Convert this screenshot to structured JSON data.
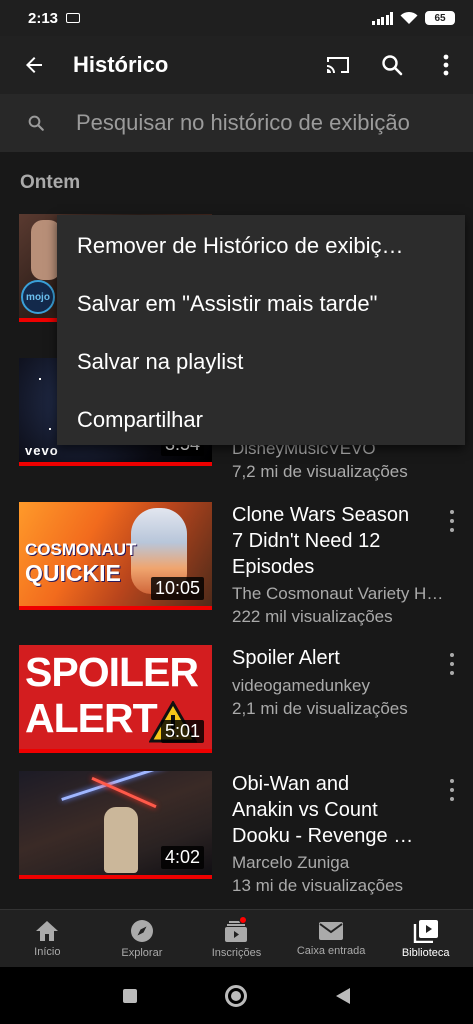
{
  "status_bar": {
    "time": "2:13",
    "battery": "65"
  },
  "app_bar": {
    "title": "Histórico"
  },
  "search": {
    "placeholder": "Pesquisar no histórico de exibição"
  },
  "section": {
    "heading": "Ontem"
  },
  "context_menu": {
    "items": [
      "Remover de Histórico de exibiç…",
      "Salvar em \"Assistir mais tarde\"",
      "Salvar na playlist",
      "Compartilhar"
    ]
  },
  "videos": [
    {
      "title": "",
      "channel": "",
      "views": "",
      "duration": ""
    },
    {
      "title": "",
      "channel": "DisneyMusicVEVO",
      "views": "7,2 mi de visualizações",
      "duration": "3:54"
    },
    {
      "title_lines": [
        "Clone Wars Season",
        "7 Didn't Need 12",
        "Episodes"
      ],
      "channel": "The Cosmonaut Variety H…",
      "views": "222 mil visualizações",
      "duration": "10:05",
      "thumb_text": [
        "COSMONAUT",
        "QUICKIE"
      ]
    },
    {
      "title_lines": [
        "Spoiler Alert"
      ],
      "channel": "videogamedunkey",
      "views": "2,1 mi de visualizações",
      "duration": "5:01",
      "thumb_text": [
        "SPOILER",
        "ALERT"
      ]
    },
    {
      "title_lines": [
        "Obi-Wan and",
        "Anakin vs Count",
        "Dooku - Revenge …"
      ],
      "channel": "Marcelo Zuniga",
      "views": "13 mi de visualizações",
      "duration": "4:02"
    }
  ],
  "thumb_labels": {
    "mojo": "mojo",
    "vevo": "vevo"
  },
  "bottom_nav": {
    "items": [
      "Início",
      "Explorar",
      "Inscrições",
      "Caixa entrada",
      "Biblioteca"
    ],
    "active": "Biblioteca"
  },
  "colors": {
    "accent": "#ff0000",
    "progress": "#e00000",
    "background": "#181818",
    "menu": "#2c2c2c"
  }
}
